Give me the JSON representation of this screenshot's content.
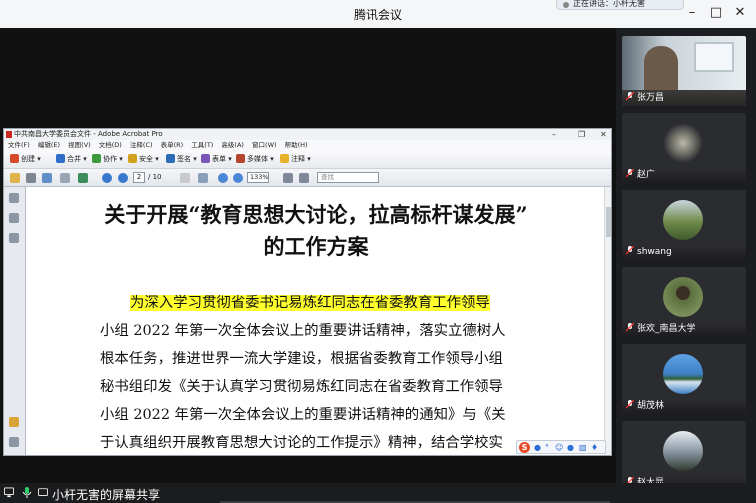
{
  "app": {
    "title": "腾讯会议",
    "notification": "正在讲话：小杆无害"
  },
  "share": {
    "presenter_label": "小杆无害的屏幕共享"
  },
  "acrobat": {
    "title": "中共南昌大学委员会文件 - Adobe Acrobat Pro",
    "menu": [
      "文件(F)",
      "编辑(E)",
      "视图(V)",
      "文档(D)",
      "注释(C)",
      "表单(R)",
      "工具(T)",
      "高级(A)",
      "窗口(W)",
      "帮助(H)"
    ],
    "toolbar_tasks": [
      {
        "label": "创建",
        "color": "#d64a2a"
      },
      {
        "label": "合并",
        "color": "#2f6fc9"
      },
      {
        "label": "协作",
        "color": "#3c9a3c"
      },
      {
        "label": "安全",
        "color": "#d3a21f"
      },
      {
        "label": "签名",
        "color": "#2c6bb5"
      },
      {
        "label": "表单",
        "color": "#7a55b8"
      },
      {
        "label": "多媒体",
        "color": "#b5452c"
      },
      {
        "label": "注释",
        "color": "#e7b12a"
      }
    ],
    "page_current": "2",
    "page_total": "/ 10",
    "zoom": "133%",
    "find_placeholder": "查找"
  },
  "document": {
    "title_line1": "关于开展“教育思想大讨论，拉高标杆谋发展”",
    "title_line2": "的工作方案",
    "highlighted": "为深入学习贯彻省委书记易炼红同志在省委教育工作领导",
    "lines": [
      "小组 2022 年第一次全体会议上的重要讲话精神，落实立德树人",
      "根本任务，推进世界一流大学建设，根据省委教育工作领导小组",
      "秘书组印发《关于认真学习贯彻易炼红同志在省委教育工作领导",
      "小组 2022 年第一次全体会议上的重要讲话精神的通知》与《关",
      "于认真组织开展教育思想大讨论的工作提示》精神，结合学校实"
    ]
  },
  "ime": {
    "logo": "S"
  },
  "participants": [
    {
      "name": "张万昌",
      "kind": "video"
    },
    {
      "name": "赵广",
      "kind": "avatar",
      "color": "#6d6d66"
    },
    {
      "name": "shwang",
      "kind": "avatar",
      "color": "#6f8a4a"
    },
    {
      "name": "张欢_南昌大学",
      "kind": "avatar",
      "color": "#5b6f3f"
    },
    {
      "name": "胡茂林",
      "kind": "avatar",
      "color": "#3e7fc4"
    },
    {
      "name": "赵大显",
      "kind": "avatar",
      "color": "#8c9aa6"
    }
  ]
}
